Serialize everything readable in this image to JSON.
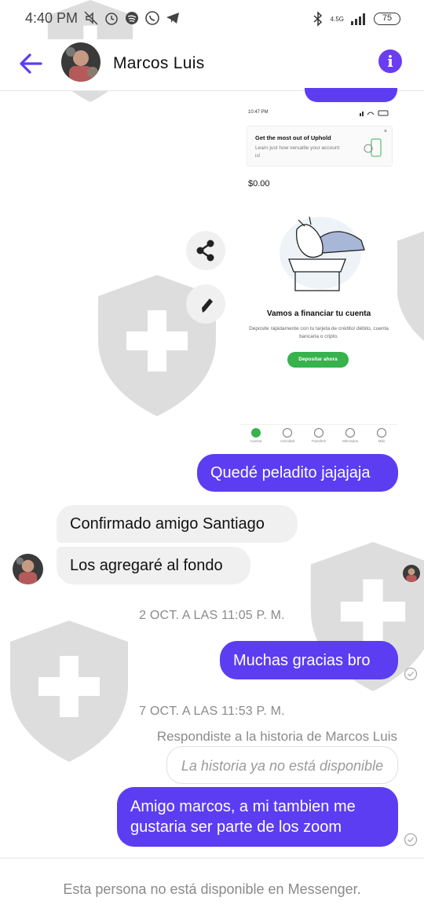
{
  "status_bar": {
    "time": "4:40 PM",
    "network": "4.5G",
    "battery": "75",
    "icons": [
      "mute-icon",
      "alarm-icon",
      "spotify-icon",
      "whatsapp-icon",
      "telegram-icon",
      "bluetooth-icon",
      "signal-icon"
    ]
  },
  "header": {
    "contact_name": "Marcos Luis",
    "back_icon": "back-arrow-icon",
    "info_icon": "info-icon",
    "info_symbol": "i"
  },
  "shared_screenshot": {
    "time": "10:47 PM",
    "card_title": "Get the most out of Uphold",
    "card_subtitle": "Learn just how versatile your account is!",
    "card_close": "×",
    "balance": "$0.00",
    "heading": "Vamos a financiar tu cuenta",
    "description": "Deposite rápidamente con tu tarjeta de crédito/ débito, cuenta bancaria o cripto.",
    "button": "Depositar ahora",
    "nav": [
      "Cuenta",
      "Actividad",
      "Transferir",
      "Mercados",
      "Más"
    ]
  },
  "messages": [
    {
      "id": "m1",
      "direction": "out",
      "text": "Quedé peladito jajajaja"
    },
    {
      "id": "m2",
      "direction": "in",
      "text": "Confirmado amigo Santiago"
    },
    {
      "id": "m3",
      "direction": "in",
      "text": "Los agregaré al fondo"
    },
    {
      "id": "m4",
      "direction": "out",
      "text": "Muchas gracias bro"
    },
    {
      "id": "m5",
      "direction": "out",
      "text": "Amigo marcos, a mi tambien me gustaria ser parte de los zoom"
    }
  ],
  "timestamps": [
    "2 OCT. A LAS 11:05 P. M.",
    "7 OCT. A LAS 11:53 P. M."
  ],
  "story_reply": {
    "note": "Respondiste a la historia de Marcos Luis",
    "unavailable": "La historia ya no está disponible"
  },
  "footer": {
    "text": "Esta persona no está disponible en Messenger."
  },
  "colors": {
    "accent": "#5c3df2",
    "incoming_bubble": "#f0f0f0",
    "deposit_green": "#37b24d"
  }
}
